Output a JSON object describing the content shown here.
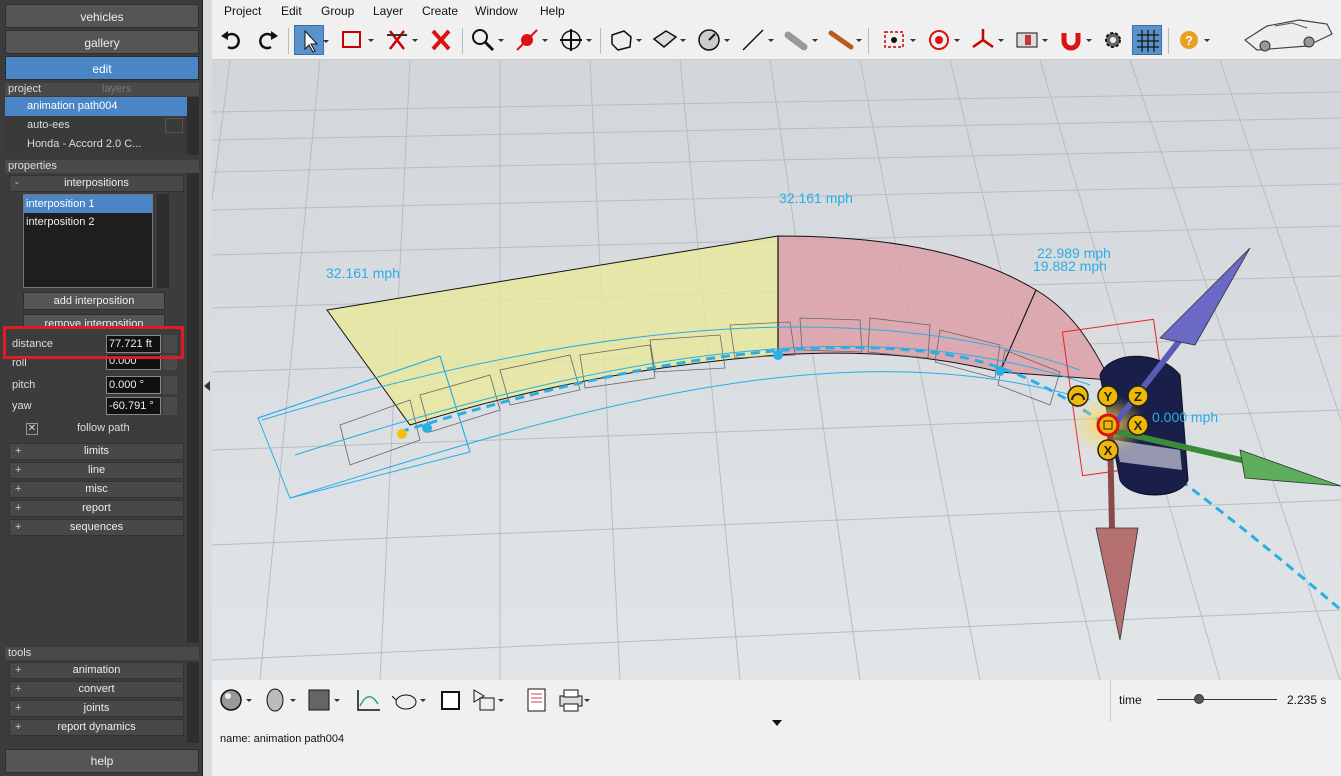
{
  "nav": {
    "vehicles": "vehicles",
    "gallery": "gallery",
    "edit": "edit",
    "help": "help"
  },
  "project_tabs": {
    "project": "project",
    "layers": "layers"
  },
  "project_items": [
    "animation path004",
    "auto-ees",
    "Honda - Accord 2.0 C..."
  ],
  "properties_header": "properties",
  "groups": {
    "interpositions": "interpositions",
    "limits": "limits",
    "line": "line",
    "misc": "misc",
    "report": "report",
    "sequences": "sequences"
  },
  "interpositions": [
    "interposition 1",
    "interposition 2"
  ],
  "buttons": {
    "add": "add interposition",
    "remove": "remove interposition"
  },
  "fields": {
    "distance": {
      "label": "distance",
      "value": "77.721 ft"
    },
    "roll": {
      "label": "roll",
      "value": "0.000 °"
    },
    "pitch": {
      "label": "pitch",
      "value": "0.000 °"
    },
    "yaw": {
      "label": "yaw",
      "value": "-60.791 °"
    }
  },
  "follow_path": {
    "label": "follow path",
    "checked": true
  },
  "tools_header": "tools",
  "tools": [
    "animation",
    "convert",
    "joints",
    "report dynamics"
  ],
  "menu": [
    "Project",
    "Edit",
    "Group",
    "Layer",
    "Create",
    "Window",
    "Help"
  ],
  "speeds": {
    "left": "32.161 mph",
    "top": "32.161 mph",
    "right_a": "22.989 mph",
    "right_b": "19.882 mph",
    "car": "0.000 mph"
  },
  "gizmo_labels": {
    "y": "Y",
    "z": "Z",
    "x1": "X",
    "x2": "X"
  },
  "time": {
    "label": "time",
    "value": "2.235 s",
    "fraction": 0.35
  },
  "status": "name: animation path004",
  "colors": {
    "accent": "#4a86c5",
    "highlight": "#e01b24",
    "path": "#29aee6"
  }
}
